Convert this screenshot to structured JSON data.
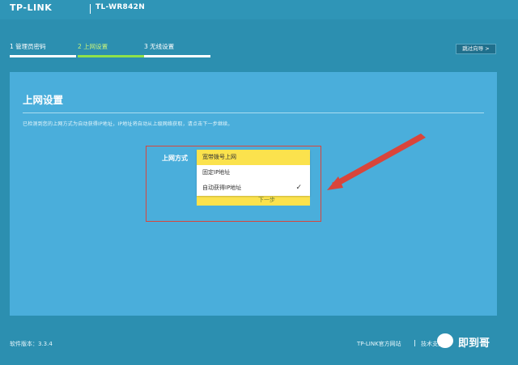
{
  "header": {
    "brand": "TP-LINK",
    "model": "TL-WR842N"
  },
  "steps": [
    {
      "label": "1 管理员密码",
      "active": false
    },
    {
      "label": "2 上网设置",
      "active": true
    },
    {
      "label": "3 无线设置",
      "active": false
    }
  ],
  "skip_label": "跳过向导 >",
  "panel": {
    "title": "上网设置",
    "description": "已检测到您的上网方式为自动获得IP地址，IP地址将自动从上级网络获取，请点击下一步继续。",
    "field_label": "上网方式",
    "hidden_button": "下一步",
    "options": [
      {
        "label": "宽带拨号上网",
        "highlighted": true,
        "selected": false
      },
      {
        "label": "固定IP地址",
        "highlighted": false,
        "selected": false
      },
      {
        "label": "自动获得IP地址",
        "highlighted": false,
        "selected": true
      }
    ],
    "check_mark": "✓"
  },
  "footer": {
    "version": "软件版本：3.3.4",
    "link_official": "TP-LINK官方网站",
    "link_support": "技术支持"
  },
  "watermark": {
    "text": "即到哥"
  },
  "colors": {
    "background": "#2c8fb0",
    "panel": "#4aaedb",
    "accent_step": "#8fe24a",
    "dropdown_highlight": "#fbe24d",
    "annotation_red": "#d9453b"
  }
}
